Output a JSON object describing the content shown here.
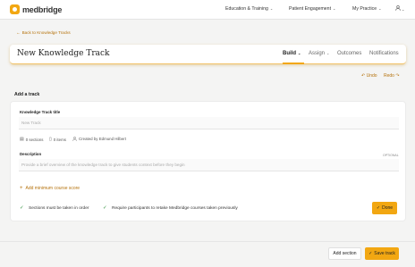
{
  "brand": {
    "name": "medbridge",
    "accent": "#f2a712"
  },
  "nav": {
    "items": [
      {
        "label": "Education & Training"
      },
      {
        "label": "Patient Engagement"
      },
      {
        "label": "My Practice"
      }
    ],
    "chevron": "⌄",
    "user_icon": "user-icon"
  },
  "back_link": "Back to Knowledge Tracks",
  "header": {
    "title": "New Knowledge Track",
    "tabs": [
      {
        "label": "Build",
        "active": true
      },
      {
        "label": "Assign",
        "active": false
      },
      {
        "label": "Outcomes",
        "active": false
      },
      {
        "label": "Notifications",
        "active": false
      }
    ]
  },
  "toolbar": {
    "undo": "Undo",
    "redo": "Redo"
  },
  "add_track_label": "Add a track",
  "form": {
    "title_label": "Knowledge Track title",
    "title_placeholder": "New Track",
    "meta": {
      "sections": "0 sections",
      "items": "0 items",
      "created_by": "Created by Edmund Hilbert"
    },
    "description_label": "Description",
    "description_optional": "OPTIONAL",
    "description_placeholder": "Provide a brief overview of the knowledge track to give students context before they begin",
    "add_min_score": "Add minimum course score",
    "options": [
      {
        "label": "Sections must be taken in order",
        "checked": true
      },
      {
        "label": "Require participants to retake Medbridge courses taken previously",
        "checked": true
      }
    ],
    "done": "Done"
  },
  "footer": {
    "add_section": "Add section",
    "save_track": "Save track"
  }
}
